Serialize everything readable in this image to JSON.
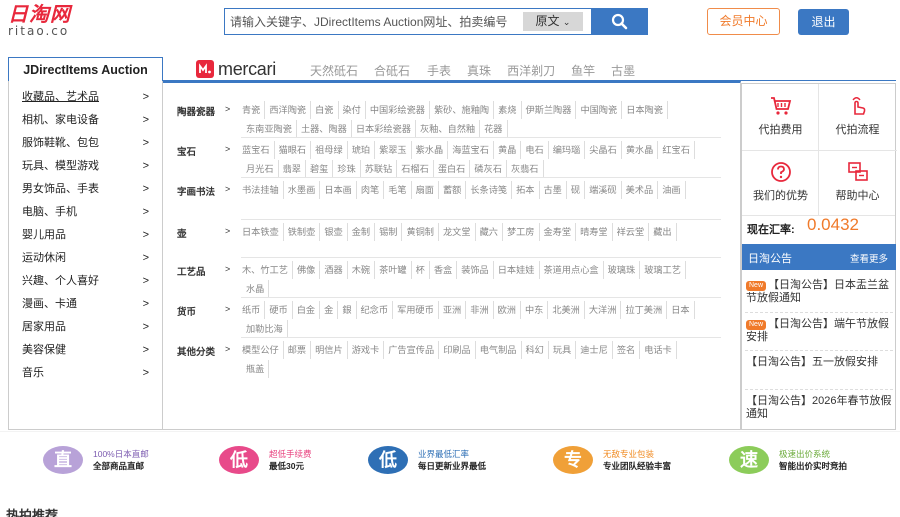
{
  "logo": {
    "cn": "日淘网",
    "en": "ritao.co"
  },
  "search": {
    "placeholder": "请输入关键字、JDirectItems Auction网址、拍卖编号",
    "option": "原文"
  },
  "header": {
    "member": "会员中心",
    "logout": "退出"
  },
  "nav": {
    "jdirect": "JDirectItems Auction",
    "mercari": "mercari",
    "tabs": [
      "天然砥石",
      "合砥石",
      "手表",
      "真珠",
      "西洋剃刀",
      "鱼竿",
      "古墨"
    ]
  },
  "sidebar": [
    "收藏品、艺术品",
    "相机、家电设备",
    "服饰鞋靴、包包",
    "玩具、模型游戏",
    "男女饰品、手表",
    "电脑、手机",
    "婴儿用品",
    "运动休闲",
    "兴趣、个人喜好",
    "漫画、卡通",
    "居家用品",
    "美容保健",
    "音乐"
  ],
  "sidebar_arrow": ">",
  "categories": [
    {
      "name": "陶器瓷器",
      "items": [
        "青瓷",
        "西洋陶瓷",
        "白瓷",
        "染付",
        "中国彩绘瓷器",
        "紫砂、施釉陶",
        "素烧",
        "伊斯兰陶器",
        "中国陶瓷",
        "日本陶瓷",
        "东南亚陶瓷",
        "土器、陶器",
        "日本彩绘瓷器",
        "灰釉、自然釉",
        "花器"
      ]
    },
    {
      "name": "宝石",
      "items": [
        "蓝宝石",
        "猫眼石",
        "祖母绿",
        "琥珀",
        "紫翠玉",
        "紫水晶",
        "海蓝宝石",
        "黄晶",
        "电石",
        "编玛瑙",
        "尖晶石",
        "黄水晶",
        "红宝石",
        "月光石",
        "翡翠",
        "碧玺",
        "珍珠",
        "苏联钻",
        "石榴石",
        "蛋白石",
        "磷灰石",
        "灰翡石"
      ]
    },
    {
      "name": "字画书法",
      "items": [
        "书法挂轴",
        "水墨画",
        "日本画",
        "肉笔",
        "毛笔",
        "扇面",
        "蓄额",
        "长条诗笺",
        "拓本",
        "古墨",
        "砚",
        "端溪砚",
        "美术品",
        "油画"
      ]
    },
    {
      "name": "壶",
      "items": [
        "日本铁壶",
        "铁制壶",
        "银壶",
        "金制",
        "锡制",
        "黄铜制",
        "龙文堂",
        "藏六",
        "梦工房",
        "金寿堂",
        "晴寿堂",
        "祥云堂",
        "藏出"
      ]
    },
    {
      "name": "工艺品",
      "items": [
        "木、竹工艺",
        "佛像",
        "酒器",
        "木碗",
        "茶叶罐",
        "杯",
        "香盒",
        "装饰品",
        "日本娃娃",
        "茶道用点心盒",
        "玻璃珠",
        "玻璃工艺",
        "水晶"
      ]
    },
    {
      "name": "货币",
      "items": [
        "纸币",
        "硬币",
        "白金",
        "金",
        "銀",
        "纪念币",
        "军用硬币",
        "亚洲",
        "非洲",
        "欧洲",
        "中东",
        "北美洲",
        "大洋洲",
        "拉丁美洲",
        "日本",
        "加勒比海"
      ]
    },
    {
      "name": "其他分类",
      "items": [
        "模型公仔",
        "邮票",
        "明信片",
        "游戏卡",
        "广告宣传品",
        "印刷品",
        "电气制品",
        "科幻",
        "玩具",
        "迪士尼",
        "签名",
        "电话卡",
        "瓶盖"
      ]
    }
  ],
  "category_arrow": ">",
  "right": {
    "links": [
      "代拍费用",
      "代拍流程",
      "我们的优势",
      "帮助中心"
    ],
    "rate_label": "现在汇率:",
    "rate_value": "0.0432",
    "announce_title": "日淘公告",
    "announce_more": "查看更多",
    "news": [
      {
        "new": true,
        "text": "【日淘公告】日本盂兰盆节放假通知"
      },
      {
        "new": true,
        "text": "【日淘公告】端午节放假安排"
      },
      {
        "new": false,
        "text": "【日淘公告】五一放假安排"
      },
      {
        "new": false,
        "text": "【日淘公告】2026年春节放假通知"
      }
    ],
    "new_badge": "New"
  },
  "features": [
    {
      "char": "直",
      "t1": "100%日本直邮",
      "t2": "全部商品直邮",
      "color": "#b8a2d8",
      "t1color": "#7c5bb0"
    },
    {
      "char": "低",
      "t1": "超低手续费",
      "t2": "最低30元",
      "color": "#e84a8a",
      "t1color": "#e8407d"
    },
    {
      "char": "低",
      "t1": "业界最低汇率",
      "t2": "每日更新业界最低",
      "color": "#2e6fb5",
      "t1color": "#2e6fb5"
    },
    {
      "char": "专",
      "t1": "无敌专业包装",
      "t2": "专业团队经验丰富",
      "color": "#f0a038",
      "t1color": "#f08a20"
    },
    {
      "char": "速",
      "t1": "极速出价系统",
      "t2": "智能出价实时竞拍",
      "color": "#8ccc5a",
      "t1color": "#6aaa38"
    }
  ],
  "hot": "热拍推荐"
}
